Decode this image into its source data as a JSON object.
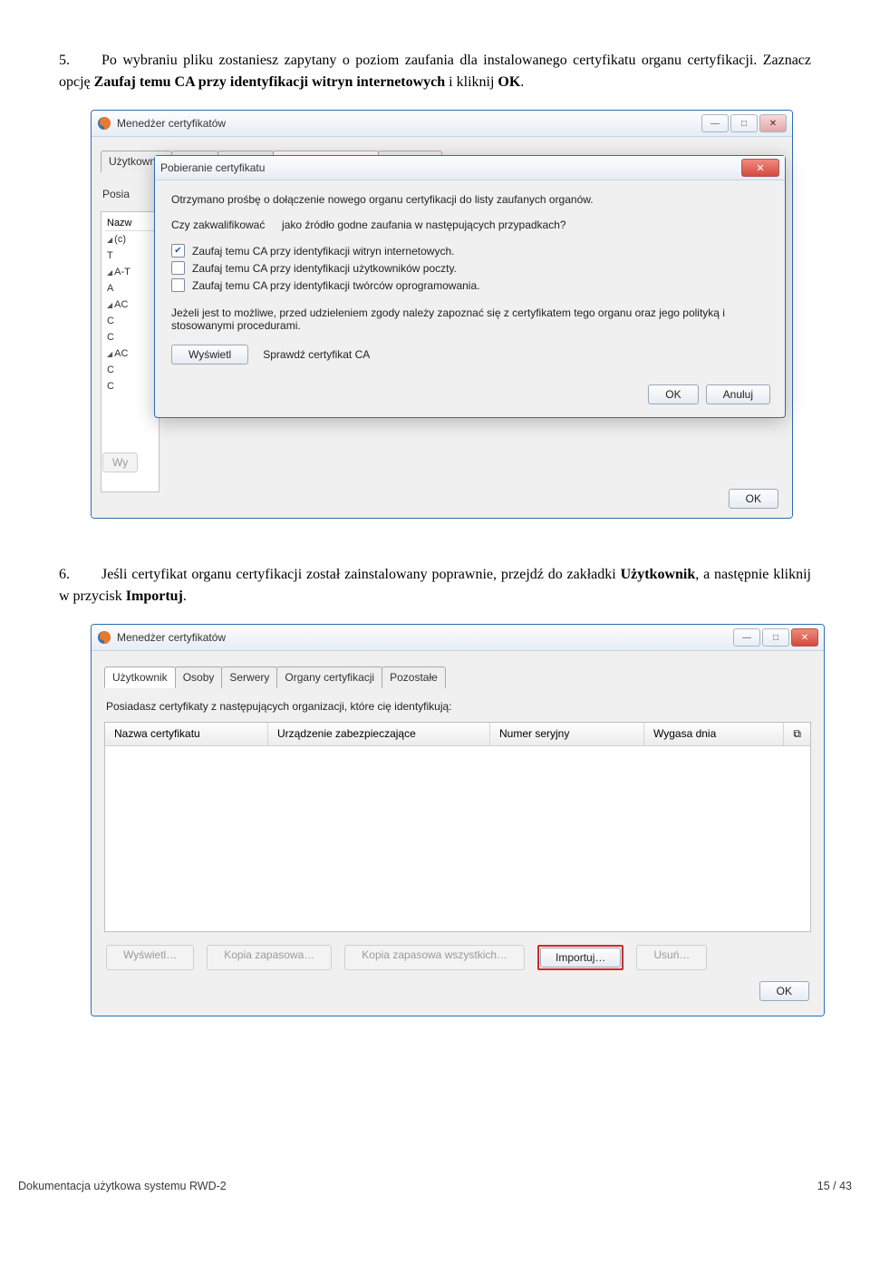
{
  "step5": {
    "number": "5.",
    "text_a": "Po wybraniu pliku zostaniesz zapytany o poziom zaufania dla instalowanego certyfikatu organu certyfikacji. Zaznacz opcję ",
    "bold_a": "Zaufaj temu CA przy identyfikacji witryn internetowych",
    "text_b": " i kliknij ",
    "bold_b": "OK",
    "text_c": "."
  },
  "step6": {
    "number": "6.",
    "text_a": "Jeśli certyfikat organu certyfikacji został zainstalowany poprawnie, przejdź do zakładki ",
    "bold_a": "Użytkownik",
    "text_b": ", a następnie kliknij w przycisk ",
    "bold_b": "Importuj",
    "text_c": "."
  },
  "mgr": {
    "title": "Menedżer certyfikatów",
    "win_min": "—",
    "win_max": "□",
    "win_close": "✕",
    "tabs": [
      "Użytkownik",
      "Osoby",
      "Serwery",
      "Organy certyfikacji",
      "Pozostałe"
    ],
    "active1_index": 3,
    "posia": "Posia",
    "listhdr": "Nazw",
    "listitems": [
      "(c)",
      "T",
      "A-T",
      "A",
      "AC",
      "C",
      "C",
      "AC",
      "C",
      "C"
    ],
    "btn_wy": "Wy",
    "ok": "OK"
  },
  "dlg": {
    "title": "Pobieranie certyfikatu",
    "close": "✕",
    "line1": "Otrzymano prośbę o dołączenie nowego organu certyfikacji do listy zaufanych organów.",
    "line2a": "Czy zakwalifikować ",
    "line2blur": "      ",
    "line2b": " jako źródło godne zaufania w następujących przypadkach?",
    "cb1": "Zaufaj temu CA przy identyfikacji witryn internetowych.",
    "cb2": "Zaufaj temu CA przy identyfikacji użytkowników poczty.",
    "cb3": "Zaufaj temu CA przy identyfikacji twórców oprogramowania.",
    "note": "Jeżeli jest to możliwe, przed udzieleniem zgody należy zapoznać się z certyfikatem tego organu oraz jego polityką i stosowanymi procedurami.",
    "view": "Wyświetl",
    "verify": "Sprawdź certyfikat CA",
    "ok": "OK",
    "cancel": "Anuluj"
  },
  "mgr2": {
    "title": "Menedżer certyfikatów",
    "info": "Posiadasz certyfikaty z następujących organizacji, które cię identyfikują:",
    "cols": [
      "Nazwa certyfikatu",
      "Urządzenie zabezpieczające",
      "Numer seryjny",
      "Wygasa dnia"
    ],
    "col_menu_glyph": "⧉",
    "btns": {
      "view": "Wyświetl…",
      "backup": "Kopia zapasowa…",
      "backup_all": "Kopia zapasowa wszystkich…",
      "import": "Importuj…",
      "delete": "Usuń…"
    },
    "ok": "OK"
  },
  "footer": {
    "left": "Dokumentacja użytkowa systemu RWD-2",
    "right": "15 / 43"
  }
}
